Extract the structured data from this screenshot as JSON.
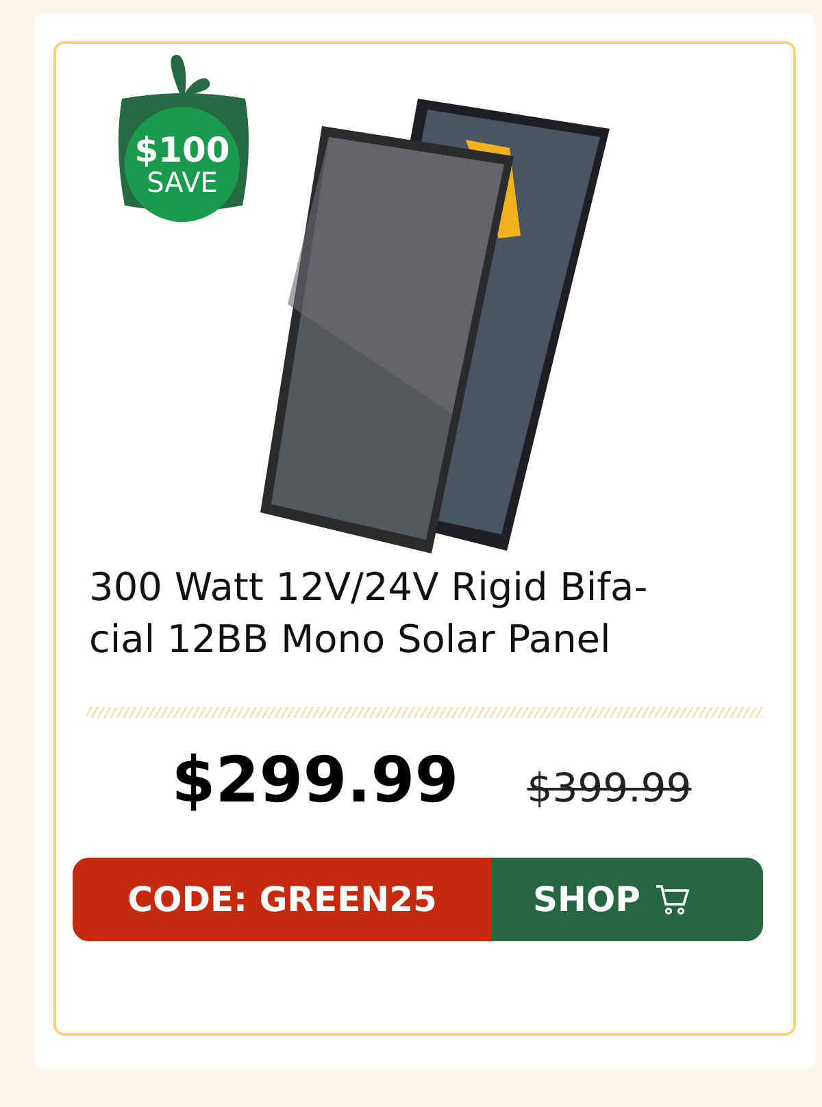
{
  "badge": {
    "amount": "$100",
    "label": "SAVE"
  },
  "product": {
    "title": "300 Watt 12V/24V Rigid Bifa-cial 12BB Mono Solar Panel",
    "price": "$299.99",
    "original_price": "$399.99"
  },
  "promo": {
    "code": "CODE: GREEN25",
    "button": "SHOP"
  }
}
